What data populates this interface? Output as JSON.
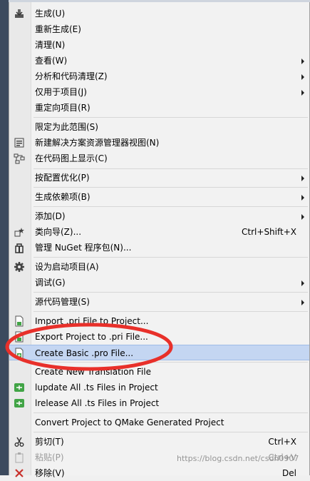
{
  "menu": {
    "build": "生成(U)",
    "rebuild": "重新生成(E)",
    "clean": "清理(N)",
    "view": "查看(W)",
    "analyze": "分析和代码清理(Z)",
    "project_only": "仅用于项目(J)",
    "retarget": "重定向项目(R)",
    "scope": "限定为此范围(S)",
    "new_view": "新建解决方案资源管理器视图(N)",
    "code_map": "在代码图上显示(C)",
    "profile_guided": "按配置优化(P)",
    "build_deps": "生成依赖项(B)",
    "add": "添加(D)",
    "class_wizard": "类向导(Z)...",
    "class_wizard_shortcut": "Ctrl+Shift+X",
    "nuget": "管理 NuGet 程序包(N)...",
    "startup": "设为启动项目(A)",
    "debug": "调试(G)",
    "source_control": "源代码管理(S)",
    "import_pri": "Import .pri File to Project...",
    "export_pri": "Export Project to .pri File...",
    "create_pro": "Create Basic .pro File...",
    "create_translation": "Create New Translation File",
    "lupdate": "lupdate All .ts Files in Project",
    "lrelease": "lrelease All .ts Files in Project",
    "convert_qmake": "Convert Project to QMake Generated Project",
    "cut": "剪切(T)",
    "cut_shortcut": "Ctrl+X",
    "paste": "粘贴(P)",
    "paste_shortcut": "Ctrl+V",
    "remove": "移除(V)",
    "remove_shortcut": "Del"
  },
  "watermark": "https://blog.csdn.net/csdn0907",
  "colors": {
    "highlight": "#c4d6f2",
    "annotation_circle": "#e8302a"
  }
}
